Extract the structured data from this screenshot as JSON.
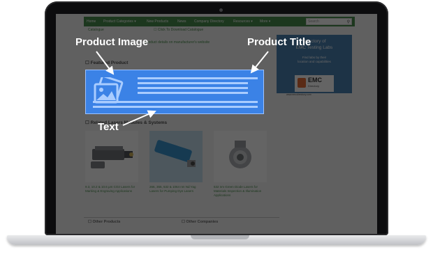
{
  "annotations": {
    "product_image": "Product Image",
    "product_title": "Product Title",
    "text": "Text"
  },
  "nav": {
    "items": [
      "Home",
      "Product Categories ▾",
      "New Products",
      "News",
      "Company Directory",
      "Resources ▾",
      "More ▾"
    ],
    "search_placeholder": "Search"
  },
  "subnav": {
    "left": "Catalogue",
    "right": "☐ Click To Download Catalogue"
  },
  "notice": "product details on manufacturer's website",
  "sections": {
    "featured": "☐ Featured Product",
    "related": "☐ Related Lasers Modules & Systems",
    "other_products": "☐ Other Products",
    "other_companies": "☐ Other Companies"
  },
  "products": [
    {
      "caption": "9.3, 10.2 & 10.6 μm CO2 Lasers for Marking & Engraving Applications"
    },
    {
      "caption": "266, 355, 532 & 1064 nm Nd:Yag Lasers for Pumping Dye Lasers"
    },
    {
      "caption": "532 nm Green Diode Lasers for Materials Inspection & Illumination Applications"
    }
  ],
  "sidebar": {
    "line1": "Directory of",
    "line2": "EMC Testing Labs",
    "line3": "Find labs by their",
    "line4": "location and capabilities",
    "logo_text": "EMC",
    "logo_sub": "Directory",
    "url": "www.emcdirectory.com"
  },
  "colors": {
    "nav_green": "#2e7d32",
    "highlight_blue": "#3b82e6",
    "sidebar_blue": "#2f6fa8",
    "emc_orange": "#e05a1b"
  }
}
